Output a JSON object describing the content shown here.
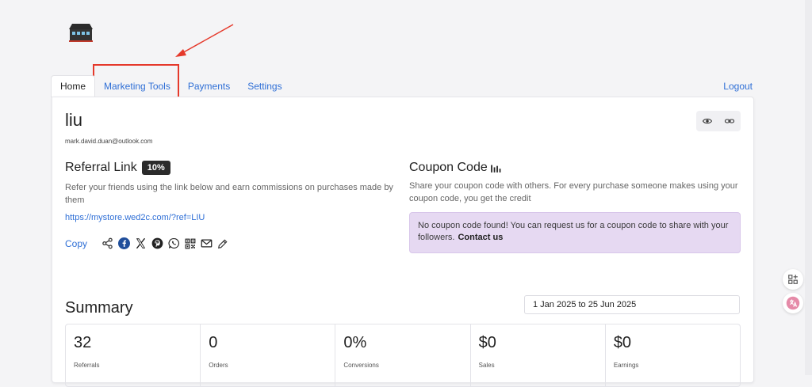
{
  "nav": {
    "tabs": [
      {
        "label": "Home",
        "active": true
      },
      {
        "label": "Marketing Tools",
        "active": false
      },
      {
        "label": "Payments",
        "active": false
      },
      {
        "label": "Settings",
        "active": false
      }
    ],
    "logout": "Logout"
  },
  "profile": {
    "name": "liu",
    "email": "mark.david.duan@outlook.com"
  },
  "referral": {
    "title": "Referral Link",
    "badge": "10%",
    "description": "Refer your friends using the link below and earn commissions on purchases made by them",
    "link": "https://mystore.wed2c.com/?ref=LIU",
    "copy_label": "Copy",
    "share_icons": [
      "share-icon",
      "facebook-icon",
      "x-icon",
      "pinterest-icon",
      "whatsapp-icon",
      "qr-code-icon",
      "mail-icon",
      "edit-icon"
    ]
  },
  "coupon": {
    "title": "Coupon Code",
    "description": "Share your coupon code with others. For every purchase someone makes using your coupon code, you get the credit",
    "alert_text": "No coupon code found! You can request us for a coupon code to share with your followers.",
    "contact_label": "Contact us"
  },
  "summary": {
    "title": "Summary",
    "date_range": "1 Jan 2025 to 25 Jun 2025",
    "stats": [
      {
        "value": "32",
        "label": "Referrals"
      },
      {
        "value": "0",
        "label": "Orders"
      },
      {
        "value": "0%",
        "label": "Conversions"
      },
      {
        "value": "$0",
        "label": "Sales"
      },
      {
        "value": "$0",
        "label": "Earnings"
      }
    ]
  },
  "colors": {
    "link": "#2f6fd6",
    "annotation": "#e5392b",
    "alert_bg": "#e6d9f2",
    "badge_bg": "#2b2b2b"
  }
}
